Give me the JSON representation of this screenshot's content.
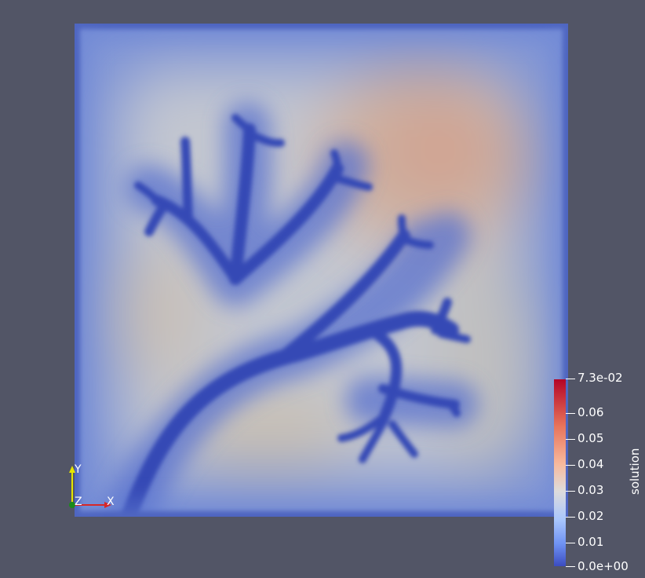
{
  "colorbar": {
    "title": "solution",
    "ticks": [
      "7.3e-02",
      "0.06",
      "0.05",
      "0.04",
      "0.03",
      "0.02",
      "0.01",
      "0.0e+00"
    ],
    "tick_values": [
      0.073,
      0.06,
      0.05,
      0.04,
      0.03,
      0.02,
      0.01,
      0.0
    ],
    "range": [
      0.0,
      0.073
    ],
    "colormap": "cool-to-warm",
    "colors": [
      "#3b4cc0",
      "#dddddd",
      "#b40426"
    ]
  },
  "axes": {
    "x_label": "X",
    "y_label": "Y",
    "z_label": "Z",
    "x_color": "#d62728",
    "y_color": "#e6e600",
    "z_color": "#1a8a1a"
  },
  "colors": {
    "background": "#525566",
    "domain_edge": "#3a4fb0",
    "channel": "#3b4cc0",
    "warm_peak": "#d2a090"
  }
}
